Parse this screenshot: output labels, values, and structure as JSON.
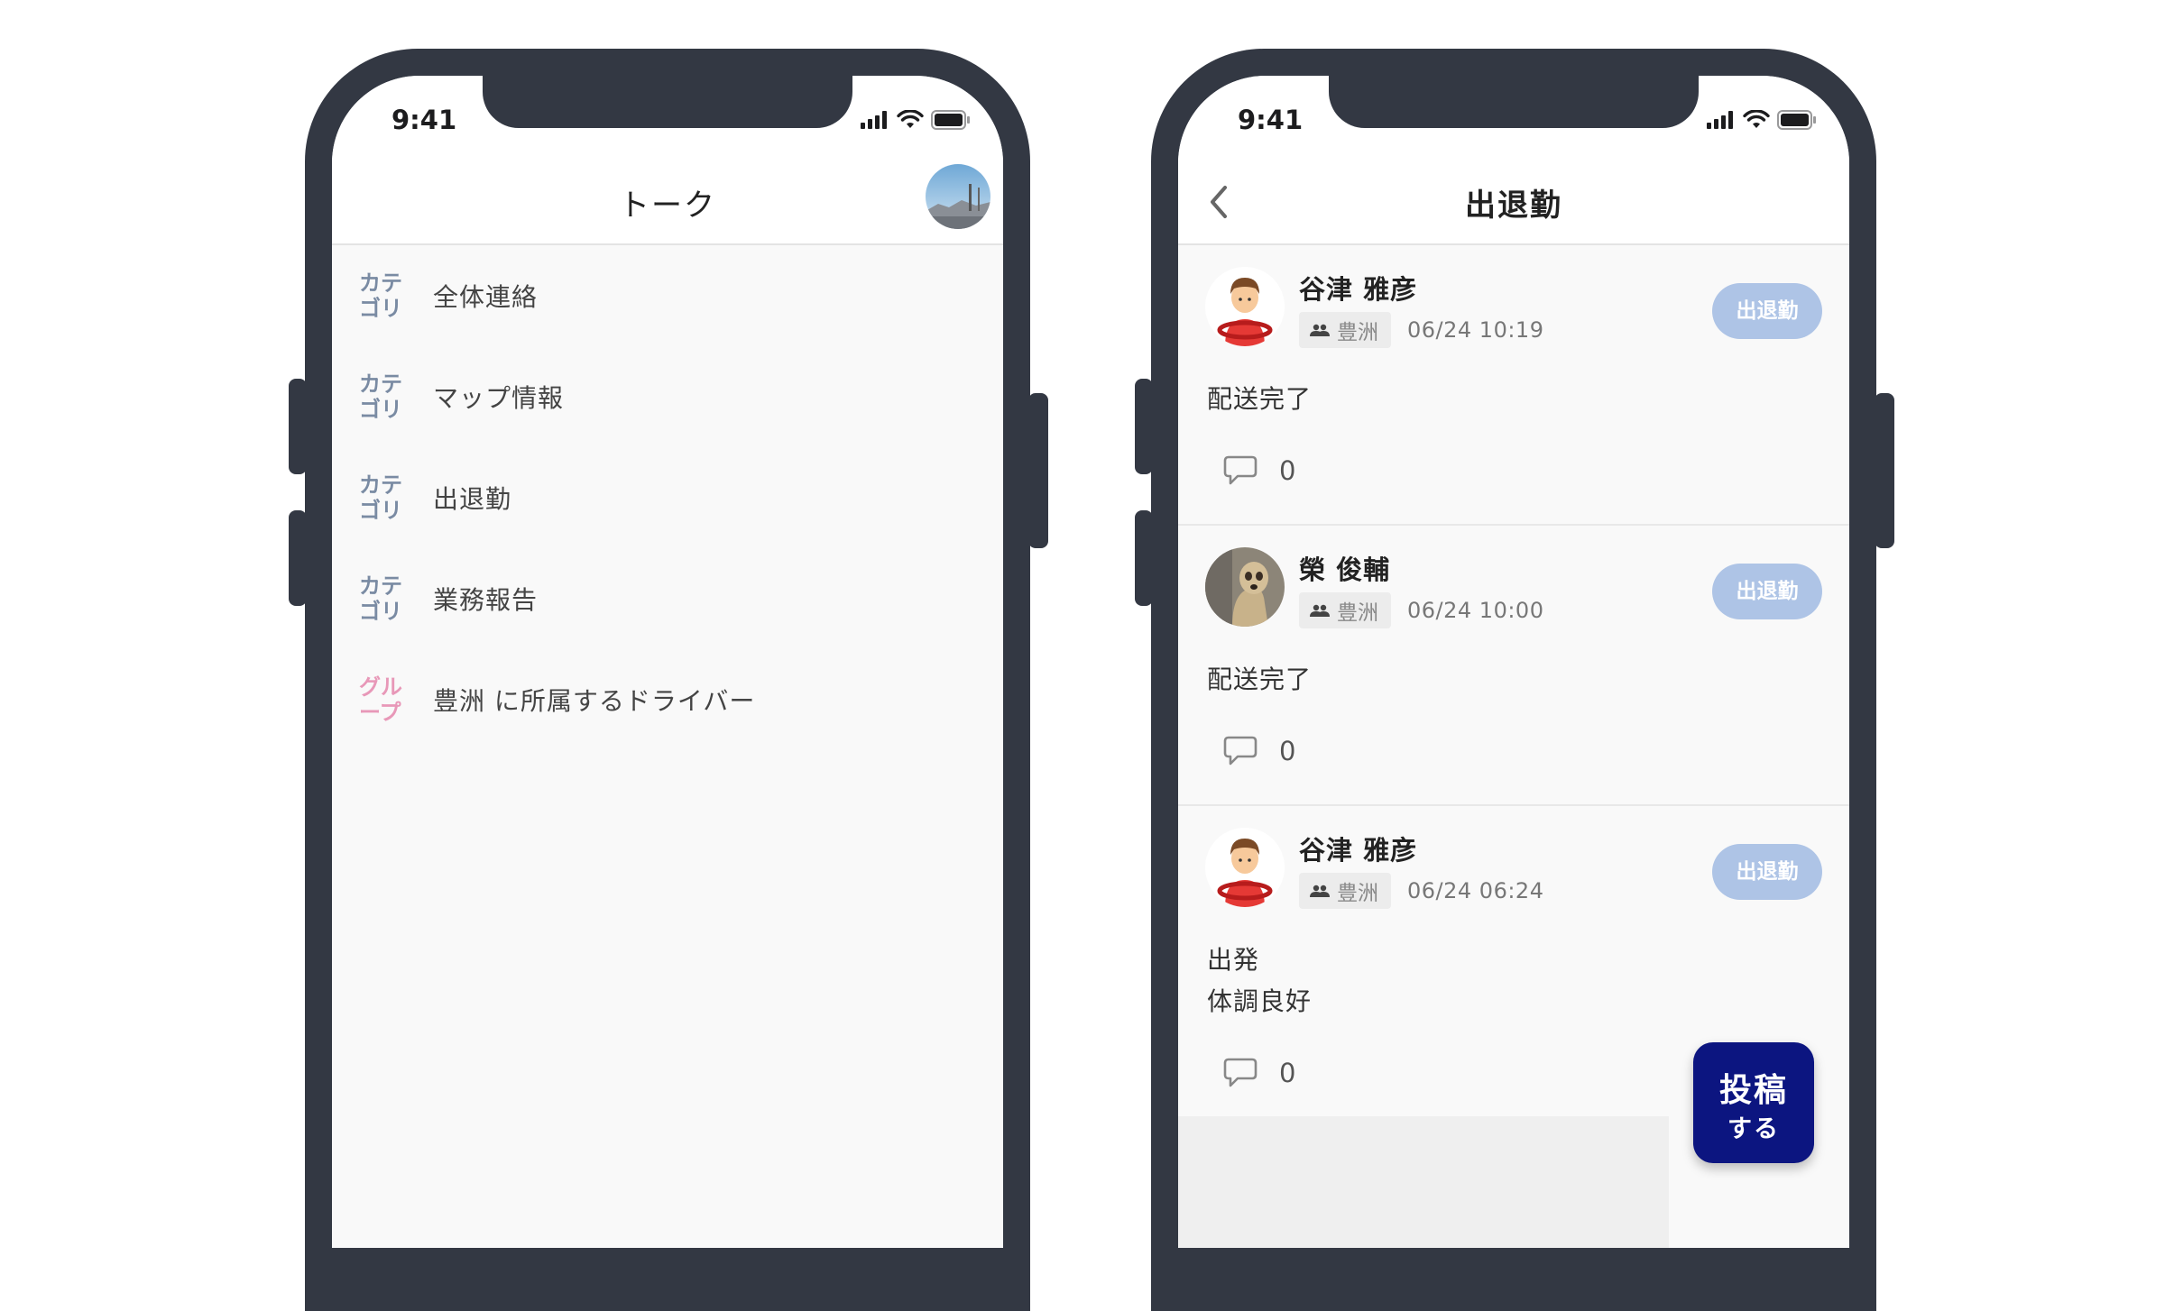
{
  "status_time": "9:41",
  "left": {
    "title": "トーク",
    "items": [
      {
        "badge": "カテゴリ",
        "label": "全体連絡"
      },
      {
        "badge": "カテゴリ",
        "label": "マップ情報"
      },
      {
        "badge": "カテゴリ",
        "label": "出退勤"
      },
      {
        "badge": "カテゴリ",
        "label": "業務報告"
      },
      {
        "badge": "グループ",
        "label": "豊洲 に所属するドライバー"
      }
    ]
  },
  "right": {
    "title": "出退勤",
    "posts": [
      {
        "name": "谷津 雅彦",
        "group": "豊洲",
        "date": "06/24 10:19",
        "tag": "出退勤",
        "lines": [
          "配送完了"
        ],
        "comments": "0"
      },
      {
        "name": "榮 俊輔",
        "group": "豊洲",
        "date": "06/24 10:00",
        "tag": "出退勤",
        "lines": [
          "配送完了"
        ],
        "comments": "0"
      },
      {
        "name": "谷津 雅彦",
        "group": "豊洲",
        "date": "06/24 06:24",
        "tag": "出退勤",
        "lines": [
          "出発",
          "体調良好"
        ],
        "comments": "0"
      }
    ],
    "fab_line1": "投稿",
    "fab_line2": "する"
  },
  "colors": {
    "frame": "#333843",
    "category_badge": "#7a8ba3",
    "group_badge": "#e898b8",
    "tag": "#aec4e6",
    "fab": "#0c1580"
  }
}
